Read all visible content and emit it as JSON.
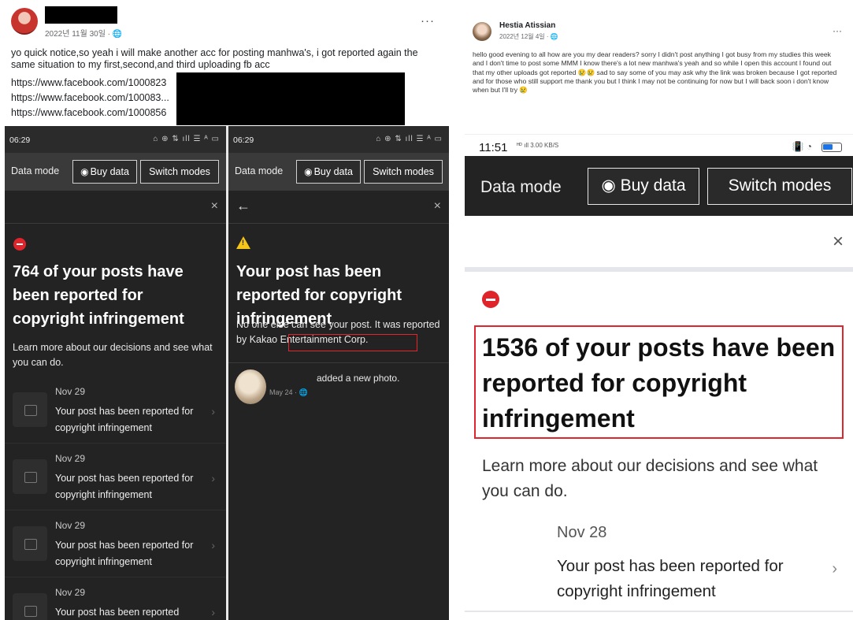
{
  "left_post": {
    "date": "2022년 11월 30일 · ",
    "globe_icon": "🌐",
    "more": "···",
    "text": "yo quick notice,so yeah i will make another acc for posting manhwa's, i got reported again the same situation to my first,second,and third uploading fb acc",
    "links": [
      "https://www.facebook.com/1000823",
      "https://www.facebook.com/100083...",
      "https://www.facebook.com/1000856"
    ]
  },
  "phone_a": {
    "time": "06:29",
    "status_icons": "⌂ ⊕ ⇅ ıll ☰ ᴬ ▭",
    "data_mode": "Data mode",
    "buy_data": "Buy data",
    "switch_modes": "Switch modes",
    "close": "×",
    "title": "764 of your posts have been reported for copyright infringement",
    "body": "Learn more about our decisions and see what you can do.",
    "notifications": [
      {
        "date": "Nov 29",
        "text": "Your post has been reported for copyright infringement"
      },
      {
        "date": "Nov 29",
        "text": "Your post has been reported for copyright infringement"
      },
      {
        "date": "Nov 29",
        "text": "Your post has been reported for copyright infringement"
      },
      {
        "date": "Nov 29",
        "text": "Your post has been reported"
      }
    ]
  },
  "phone_b": {
    "time": "06:29",
    "status_icons": "⌂ ⊕ ⇅ ıll ☰ ᴬ ▭",
    "data_mode": "Data mode",
    "buy_data": "Buy data",
    "switch_modes": "Switch modes",
    "back": "←",
    "close": "×",
    "title": "Your post has been reported for copyright infringement",
    "body_prefix": "No one else can see your post. It was reported by ",
    "reporter": "Kakao Entertainment Corp.",
    "activity_text": "added a new photo.",
    "activity_meta": "May 24 · 🌐"
  },
  "right_post": {
    "name": "Hestia Atissian",
    "date": "2022년 12월 4일 · 🌐",
    "more": "···",
    "text": "hello good evening to all how are you my dear readers? sorry I didn't post anything I got busy from my studies this week and I don't time to post some MMM I know there's a lot new manhwa's yeah and so while I open this account I found out that my other uploads got reported 😢😢 sad to say some of you may ask why the link was broken because I got reported and for those who still support me thank you but I think I may not be continuing for now but I will back soon i don't know when but I'll try 😢"
  },
  "right_phone": {
    "time": "11:51",
    "net": "ᴴᴰ ıll 3.00 KB/S",
    "status_right": "📳 ◔",
    "data_mode": "Data mode",
    "buy_data": "Buy data",
    "switch_modes": "Switch modes",
    "close": "×",
    "title": "1536 of your posts have been reported for copyright infringement",
    "body": "Learn more about our decisions and see what you can do.",
    "notification": {
      "date": "Nov 28",
      "text": "Your post has been reported for copyright infringement"
    }
  },
  "colors": {
    "dark_bg": "#232323",
    "highlight_red": "#e3262b",
    "stop_red": "#e0242b",
    "warning_yellow": "#f5c518"
  }
}
